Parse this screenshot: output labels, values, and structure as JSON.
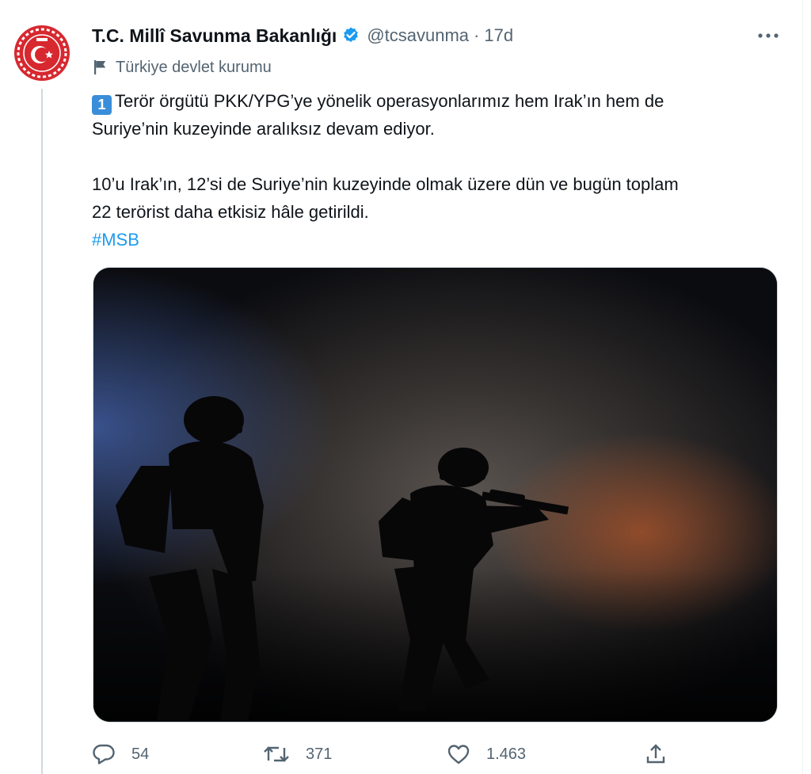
{
  "tweet": {
    "author_name": "T.C. Millî Savunma Bakanlığı",
    "handle": "@tcsavunma",
    "separator": "·",
    "time": "17d",
    "label": "Türkiye devlet kurumu",
    "number_emoji": "1",
    "paragraph1_line1": "Terör örgütü PKK/YPG’ye yönelik operasyonlarımız hem Irak’ın hem de",
    "paragraph1_line2": "Suriye’nin kuzeyinde aralıksız devam ediyor.",
    "paragraph2_line1": "10’u Irak’ın, 12’si de Suriye’nin kuzeyinde olmak üzere dün ve bugün toplam",
    "paragraph2_line2": "22 terörist daha etkisiz hâle getirildi.",
    "hashtag": "#MSB"
  },
  "actions": {
    "replies": "54",
    "retweets": "371",
    "likes": "1.463"
  },
  "icons": {
    "avatar": "ministry-emblem",
    "verified": "verified-badge-icon",
    "more": "more-icon",
    "label": "flag-icon",
    "reply": "reply-icon",
    "retweet": "retweet-icon",
    "like": "heart-icon",
    "share": "share-icon"
  },
  "colors": {
    "accent": "#1d9bf0",
    "muted": "#536471",
    "emblem_red": "#d7282f"
  }
}
